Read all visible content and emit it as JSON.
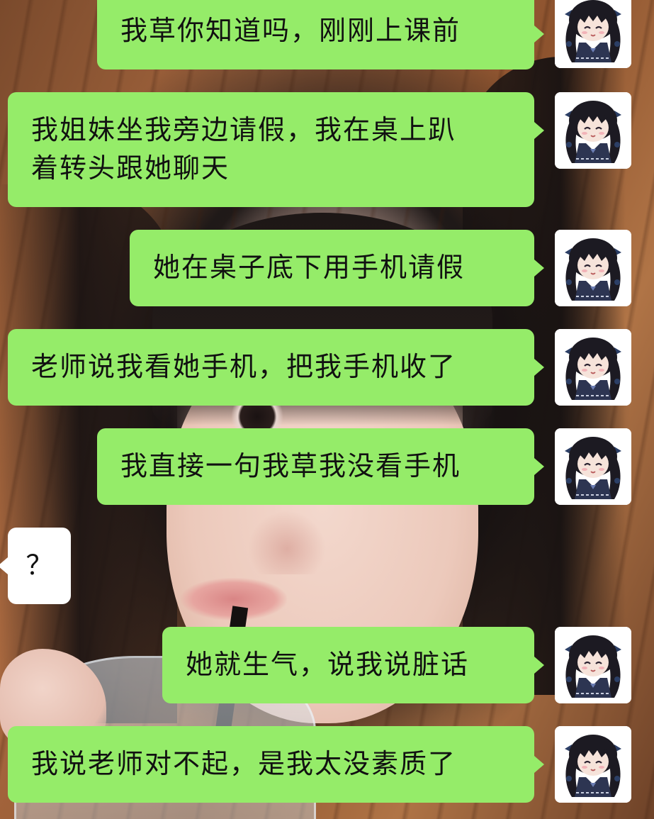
{
  "colors": {
    "sent_bubble": "#95ec69",
    "received_bubble": "#ffffff",
    "text": "#111111"
  },
  "avatar": {
    "icon": "anime-girl-avatar-icon"
  },
  "messages": [
    {
      "direction": "sent",
      "text": "我草你知道吗，刚刚上课前"
    },
    {
      "direction": "sent",
      "text": "我姐妹坐我旁边请假，我在桌上趴\n着转头跟她聊天"
    },
    {
      "direction": "sent",
      "text": "她在桌子底下用手机请假"
    },
    {
      "direction": "sent",
      "text": "老师说我看她手机，把我手机收了"
    },
    {
      "direction": "sent",
      "text": "我直接一句我草我没看手机"
    },
    {
      "direction": "received",
      "text": "？"
    },
    {
      "direction": "sent",
      "text": "她就生气，说我说脏话"
    },
    {
      "direction": "sent",
      "text": "我说老师对不起，是我太没素质了"
    }
  ]
}
